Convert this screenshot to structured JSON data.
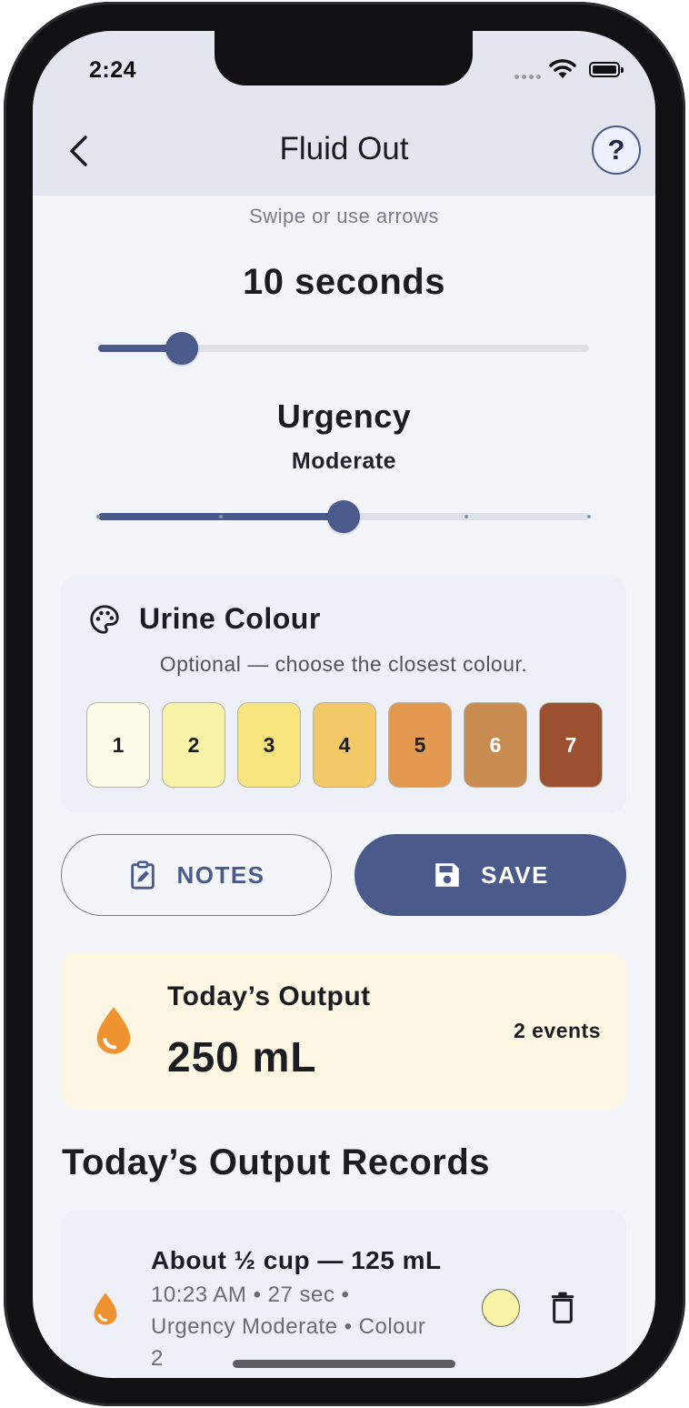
{
  "status_bar": {
    "time": "2:24"
  },
  "header": {
    "title": "Fluid Out",
    "help_label": "?"
  },
  "duration": {
    "hint": "Swipe or use arrows",
    "value_label": "10 seconds",
    "slider_fraction": 0.17
  },
  "urgency": {
    "title": "Urgency",
    "value": "Moderate",
    "level_fraction": 0.5,
    "steps": 5
  },
  "urine_colour": {
    "title": "Urine Colour",
    "subtitle": "Optional — choose the closest colour.",
    "swatches": [
      {
        "label": "1",
        "color": "#fdfbe8",
        "text_color": "#1c1d22"
      },
      {
        "label": "2",
        "color": "#f9f3a8",
        "text_color": "#1c1d22"
      },
      {
        "label": "3",
        "color": "#f6e57f",
        "text_color": "#1c1d22"
      },
      {
        "label": "4",
        "color": "#f3c967",
        "text_color": "#1c1d22"
      },
      {
        "label": "5",
        "color": "#e39a50",
        "text_color": "#1c1d22"
      },
      {
        "label": "6",
        "color": "#c98c50",
        "text_color": "#ffffff"
      },
      {
        "label": "7",
        "color": "#9b5030",
        "text_color": "#ffffff"
      }
    ]
  },
  "actions": {
    "notes_label": "NOTES",
    "save_label": "SAVE"
  },
  "todays_output": {
    "label": "Today’s Output",
    "value": "250 mL",
    "events": "2 events"
  },
  "records": {
    "title": "Today’s Output Records",
    "items": [
      {
        "title": "About ½ cup — 125 mL",
        "meta_line1": "10:23 AM • 27 sec •",
        "meta_line2": "Urgency Moderate • Colour",
        "meta_line3": "2",
        "colour": "#f9f3a8"
      }
    ]
  },
  "colors": {
    "accent": "#4a5a8b",
    "drop": "#ee9330",
    "header_bg": "#e3e5ef"
  }
}
